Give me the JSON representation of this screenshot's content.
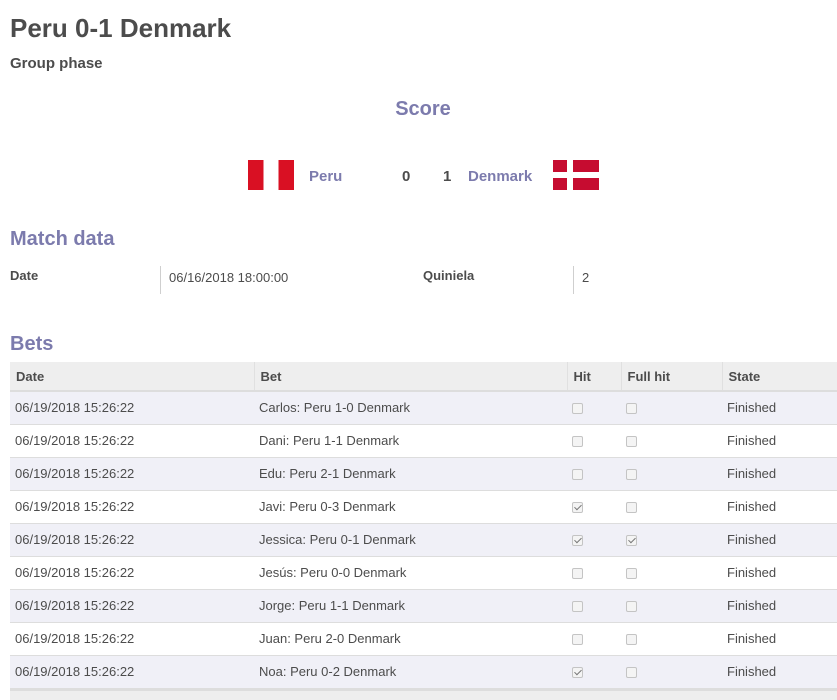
{
  "match": {
    "title": "Peru 0-1 Denmark",
    "phase": "Group phase"
  },
  "score": {
    "heading": "Score",
    "home_team": "Peru",
    "away_team": "Denmark",
    "home_goals": "0",
    "away_goals": "1"
  },
  "match_data": {
    "heading": "Match data",
    "date_label": "Date",
    "date_value": "06/16/2018 18:00:00",
    "quiniela_label": "Quiniela",
    "quiniela_value": "2"
  },
  "bets": {
    "heading": "Bets",
    "columns": [
      "Date",
      "Bet",
      "Hit",
      "Full hit",
      "State"
    ],
    "rows": [
      {
        "date": "06/19/2018 15:26:22",
        "bet": "Carlos: Peru 1-0 Denmark",
        "hit": false,
        "full_hit": false,
        "state": "Finished"
      },
      {
        "date": "06/19/2018 15:26:22",
        "bet": "Dani: Peru 1-1 Denmark",
        "hit": false,
        "full_hit": false,
        "state": "Finished"
      },
      {
        "date": "06/19/2018 15:26:22",
        "bet": "Edu: Peru 2-1 Denmark",
        "hit": false,
        "full_hit": false,
        "state": "Finished"
      },
      {
        "date": "06/19/2018 15:26:22",
        "bet": "Javi: Peru 0-3 Denmark",
        "hit": true,
        "full_hit": false,
        "state": "Finished"
      },
      {
        "date": "06/19/2018 15:26:22",
        "bet": "Jessica: Peru 0-1 Denmark",
        "hit": true,
        "full_hit": true,
        "state": "Finished"
      },
      {
        "date": "06/19/2018 15:26:22",
        "bet": "Jesús: Peru 0-0 Denmark",
        "hit": false,
        "full_hit": false,
        "state": "Finished"
      },
      {
        "date": "06/19/2018 15:26:22",
        "bet": "Jorge: Peru 1-1 Denmark",
        "hit": false,
        "full_hit": false,
        "state": "Finished"
      },
      {
        "date": "06/19/2018 15:26:22",
        "bet": "Juan: Peru 2-0 Denmark",
        "hit": false,
        "full_hit": false,
        "state": "Finished"
      },
      {
        "date": "06/19/2018 15:26:22",
        "bet": "Noa: Peru 0-2 Denmark",
        "hit": true,
        "full_hit": false,
        "state": "Finished"
      }
    ]
  },
  "icons": {
    "home_flag": "peru-flag-icon",
    "away_flag": "denmark-flag-icon",
    "checkbox": "checkbox-icon"
  },
  "colors": {
    "accent": "#7c7bad",
    "text": "#4c4c4c",
    "row_stripe": "#f0f0f7",
    "header_bg": "#eeeeee"
  }
}
